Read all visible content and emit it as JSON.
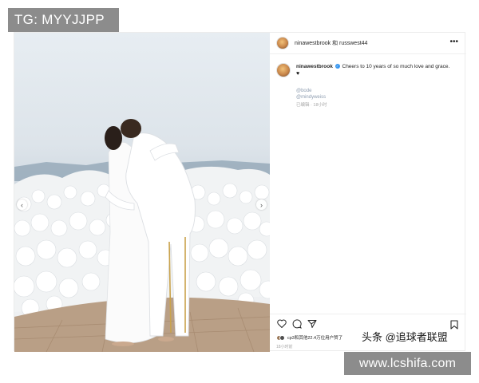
{
  "watermarks": {
    "top_left": "TG: MYYJJPP",
    "bottom_right": "www.lcshifa.com",
    "source": "头条 @追球者联盟"
  },
  "post": {
    "header": {
      "usernames": "ninawestbrook 和 russwest44",
      "more_icon": "more-horizontal-icon"
    },
    "caption": {
      "username": "ninawestbrook",
      "verified_icon": "verified-badge-icon",
      "text": "Cheers to 10 years of so much love and grace.",
      "emoji": "♥",
      "tags": [
        "@bode",
        "@mindyweiss"
      ],
      "edited_time": "已编辑 · 18小时"
    },
    "photo": {
      "alt_icons": [
        "chevron-left-icon",
        "chevron-right-icon"
      ]
    },
    "actions": {
      "like_icon": "heart-icon",
      "comment_icon": "comment-icon",
      "share_icon": "send-icon",
      "save_icon": "bookmark-icon"
    },
    "likes": "cp3和其他22.4万位用户赞了",
    "posted_time": "18小时前"
  },
  "colors": {
    "watermark_bg": "#8c8c8c",
    "link": "#8e9db0",
    "verified": "#3897f0",
    "text": "#262626",
    "muted": "#a8a8a8"
  }
}
